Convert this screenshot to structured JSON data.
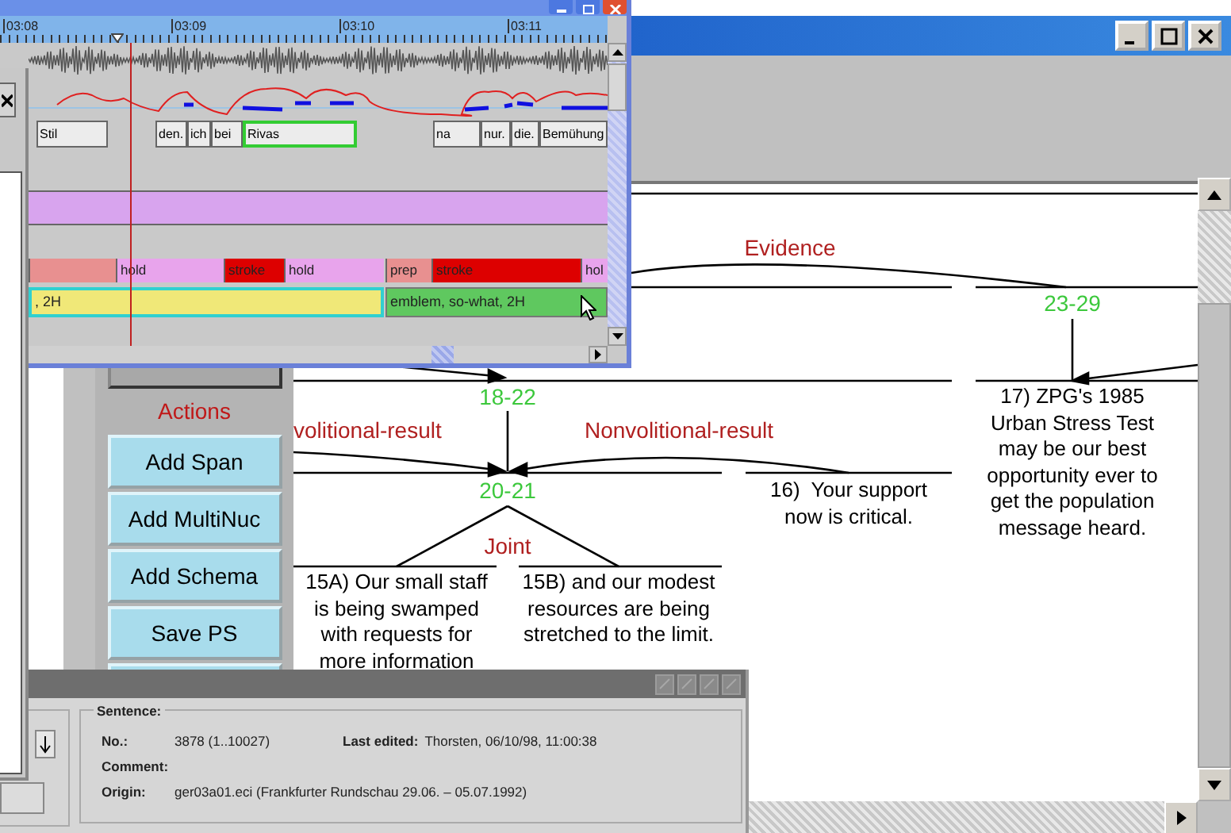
{
  "timeline": {
    "ruler_labels": [
      "03:08",
      "03:09",
      "03:10",
      "03:11"
    ],
    "word_tier": [
      {
        "text": "Stil",
        "selected": false
      },
      {
        "text": "den.",
        "selected": false
      },
      {
        "text": "ich",
        "selected": false
      },
      {
        "text": "bei",
        "selected": false
      },
      {
        "text": "Rivas",
        "selected": true
      },
      {
        "text": "na",
        "selected": false
      },
      {
        "text": "nur.",
        "selected": false
      },
      {
        "text": "die.",
        "selected": false
      },
      {
        "text": "Bemühung",
        "selected": false
      }
    ],
    "phase_tier": [
      {
        "kind": "prep"
      },
      {
        "kind": "hold",
        "text": "hold"
      },
      {
        "kind": "stroke",
        "text": "stroke"
      },
      {
        "kind": "hold",
        "text": "hold"
      },
      {
        "kind": "prep",
        "text": "prep"
      },
      {
        "kind": "stroke",
        "text": "stroke"
      },
      {
        "kind": "hold",
        "text": "hol"
      }
    ],
    "gesture_tier": [
      {
        "text": ", 2H",
        "color": "#f0e878",
        "selected": true
      },
      {
        "text": "emblem, so-what, 2H",
        "color": "#5fc85f",
        "selected": false
      }
    ]
  },
  "rst": {
    "actions": {
      "title": "Actions",
      "buttons": [
        "Add Span",
        "Add MultiNuc",
        "Add Schema",
        "Save PS"
      ]
    },
    "relations": [
      "Evidence",
      "volitional-result",
      "Nonvolitional-result",
      "Joint"
    ],
    "spans": [
      "23-29",
      "18-22",
      "20-21"
    ],
    "segments": [
      "17) ZPG's 1985\nUrban Stress Test\nmay be our best\nopportunity ever to\nget the population\nmessage heard.",
      "16)  Your support\nnow is critical.",
      "15A) Our small staff\nis being swamped\nwith requests for\nmore information",
      "15B) and our modest\nresources are being\nstretched to the limit."
    ]
  },
  "sentence": {
    "title": "Sentence:",
    "fields": [
      {
        "label": "No.:",
        "value": "3878 (1..10027)"
      },
      {
        "label": "Last edited:",
        "value": "Thorsten, 06/10/98, 11:00:38"
      },
      {
        "label": "Comment:"
      },
      {
        "label": "Origin:",
        "value": "ger03a01.eci (Frankfurter Rundschau 29.06. – 05.07.1992)"
      }
    ]
  }
}
